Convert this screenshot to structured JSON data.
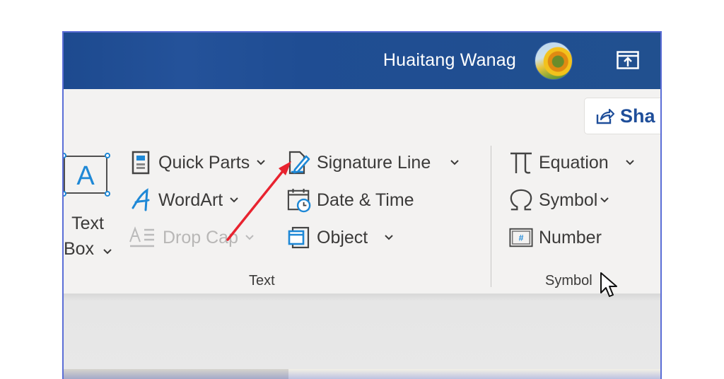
{
  "titlebar": {
    "user_name": "Huaitang Wanag",
    "avatar_icon": "sunflower-avatar",
    "restore_icon": "ribbon-display-icon"
  },
  "share": {
    "label": "Sha",
    "icon": "share-icon"
  },
  "text_group": {
    "label": "Text",
    "text_box": {
      "label_line1": "Text",
      "label_line2": "Box",
      "glyph": "A",
      "icon": "text-box-icon"
    },
    "commands": [
      {
        "label": "Quick Parts",
        "icon": "quick-parts-icon",
        "dropdown": true,
        "enabled": true
      },
      {
        "label": "WordArt",
        "icon": "wordart-icon",
        "dropdown": true,
        "enabled": true
      },
      {
        "label": "Drop Cap",
        "icon": "drop-cap-icon",
        "dropdown": true,
        "enabled": false
      },
      {
        "label": "Signature Line",
        "icon": "signature-line-icon",
        "dropdown": true,
        "enabled": true
      },
      {
        "label": "Date & Time",
        "icon": "date-time-icon",
        "dropdown": false,
        "enabled": true
      },
      {
        "label": "Object",
        "icon": "object-icon",
        "dropdown": true,
        "enabled": true
      }
    ]
  },
  "symbols_group": {
    "label": "Symbols",
    "label_visible": "Symbol",
    "commands": [
      {
        "label": "Equation",
        "icon": "pi-icon",
        "dropdown": true
      },
      {
        "label": "Symbol",
        "icon": "omega-icon",
        "dropdown": true
      },
      {
        "label": "Number",
        "icon": "number-icon",
        "dropdown": false
      }
    ]
  },
  "annotation": {
    "type": "red-arrow",
    "points_to": "Signature Line",
    "color": "#e8232f"
  },
  "colors": {
    "titlebar": "#1f4d93",
    "accent_blue": "#1e88d6",
    "ribbon_bg": "#f3f2f1"
  }
}
